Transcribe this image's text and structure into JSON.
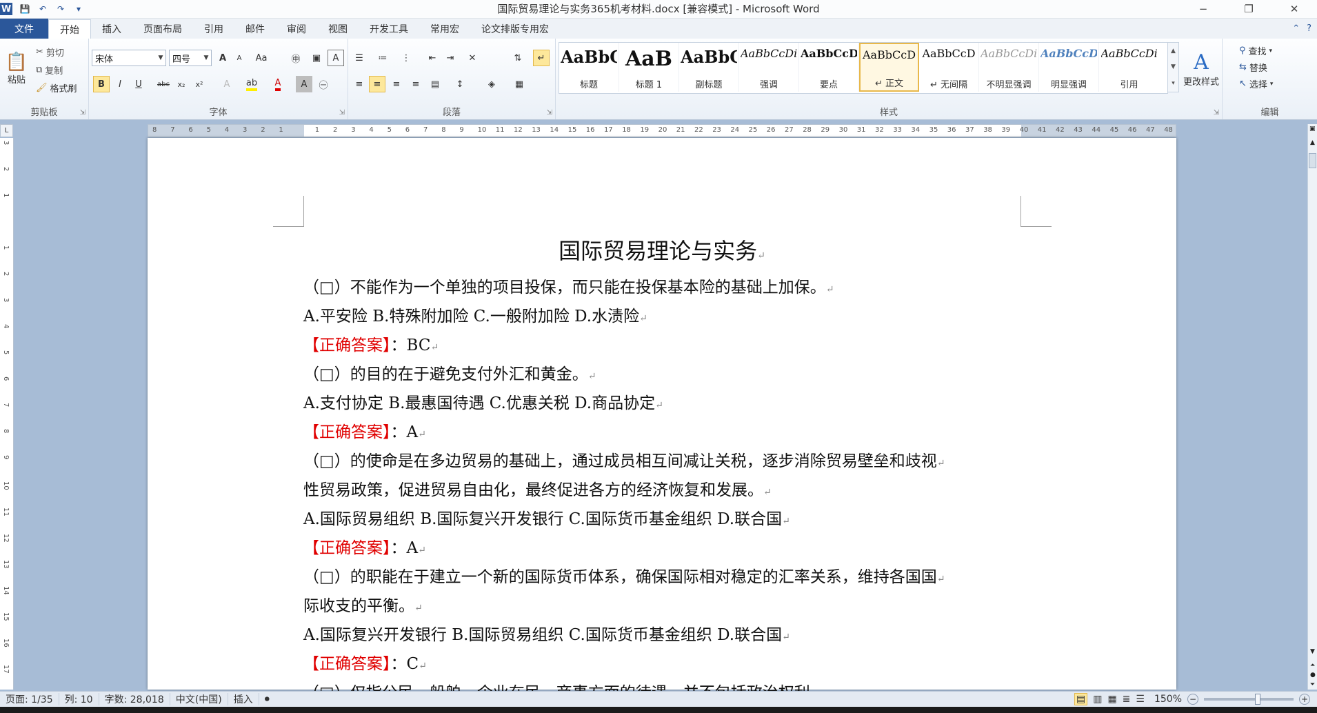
{
  "window": {
    "title": "国际贸易理论与实务365机考材料.docx [兼容模式] - Microsoft Word",
    "minimize": "−",
    "restore": "❐",
    "close": "✕"
  },
  "quick_access": {
    "word_logo": "W",
    "save": "💾",
    "undo": "↶",
    "redo": "↷",
    "more": "▾"
  },
  "tabs": [
    "文件",
    "开始",
    "插入",
    "页面布局",
    "引用",
    "邮件",
    "审阅",
    "视图",
    "开发工具",
    "常用宏",
    "论文排版专用宏"
  ],
  "active_tab": "开始",
  "clipboard": {
    "paste": "粘贴",
    "cut": "剪切",
    "copy": "复制",
    "format_painter": "格式刷",
    "label": "剪贴板"
  },
  "font": {
    "name": "宋体",
    "size": "四号",
    "label": "字体",
    "bold": "B",
    "italic": "I",
    "underline": "U",
    "strike": "abc",
    "subscript": "x₂",
    "superscript": "x²",
    "grow": "A",
    "shrink": "A",
    "case": "Aa",
    "clear": "A",
    "font_color": "A",
    "char_shading": "A"
  },
  "paragraph": {
    "label": "段落"
  },
  "styles": {
    "label": "样式",
    "items": [
      {
        "preview": "AaBbC",
        "name": "标题"
      },
      {
        "preview": "AaB",
        "name": "标题 1"
      },
      {
        "preview": "AaBbC",
        "name": "副标题"
      },
      {
        "preview": "AaBbCcDi",
        "name": "强调"
      },
      {
        "preview": "AaBbCcD",
        "name": "要点"
      },
      {
        "preview": "AaBbCcD",
        "name": "↵ 正文"
      },
      {
        "preview": "AaBbCcD",
        "name": "↵ 无间隔"
      },
      {
        "preview": "AaBbCcDi",
        "name": "不明显强调"
      },
      {
        "preview": "AaBbCcD",
        "name": "明显强调"
      },
      {
        "preview": "AaBbCcDi",
        "name": "引用"
      }
    ],
    "change_styles": "更改样式"
  },
  "editing": {
    "label": "编辑",
    "find": "查找",
    "replace": "替换",
    "select": "选择"
  },
  "ruler_h": [
    "8",
    "7",
    "6",
    "5",
    "4",
    "3",
    "2",
    "1",
    "",
    "1",
    "2",
    "3",
    "4",
    "5",
    "6",
    "7",
    "8",
    "9",
    "10",
    "11",
    "12",
    "13",
    "14",
    "15",
    "16",
    "17",
    "18",
    "19",
    "20",
    "21",
    "22",
    "23",
    "24",
    "25",
    "26",
    "27",
    "28",
    "29",
    "30",
    "31",
    "32",
    "33",
    "34",
    "35",
    "36",
    "37",
    "38",
    "39",
    "40",
    "41",
    "42",
    "43",
    "44",
    "45",
    "46",
    "47",
    "48"
  ],
  "ruler_v": [
    "3",
    "2",
    "1",
    "",
    "1",
    "2",
    "3",
    "4",
    "5",
    "6",
    "7",
    "8",
    "9",
    "10",
    "11",
    "12",
    "13",
    "14",
    "15",
    "16",
    "17"
  ],
  "document": {
    "title": "国际贸易理论与实务",
    "lines": [
      {
        "text": "（□）不能作为一个单独的项目投保，而只能在投保基本险的基础上加保。",
        "kind": "q"
      },
      {
        "text": "A.平安险 B.特殊附加险 C.一般附加险 D.水渍险",
        "kind": "opt"
      },
      {
        "label": "【正确答案】",
        "text": "：BC",
        "kind": "ans"
      },
      {
        "text": "（□）的目的在于避免支付外汇和黄金。",
        "kind": "q"
      },
      {
        "text": "A.支付协定 B.最惠国待遇 C.优惠关税 D.商品协定",
        "kind": "opt"
      },
      {
        "label": "【正确答案】",
        "text": "：A",
        "kind": "ans"
      },
      {
        "text": "（□）的使命是在多边贸易的基础上，通过成员相互间减让关税，逐步消除贸易壁垒和歧视",
        "kind": "q"
      },
      {
        "text": "性贸易政策，促进贸易自由化，最终促进各方的经济恢复和发展。",
        "kind": "q"
      },
      {
        "text": "A.国际贸易组织 B.国际复兴开发银行 C.国际货币基金组织 D.联合国",
        "kind": "opt"
      },
      {
        "label": "【正确答案】",
        "text": "：A",
        "kind": "ans"
      },
      {
        "text": "（□）的职能在于建立一个新的国际货币体系，确保国际相对稳定的汇率关系，维持各国国",
        "kind": "q"
      },
      {
        "text": "际收支的平衡。",
        "kind": "q"
      },
      {
        "text": "A.国际复兴开发银行 B.国际贸易组织 C.国际货币基金组织 D.联合国",
        "kind": "opt"
      },
      {
        "label": "【正确答案】",
        "text": "：C",
        "kind": "ans"
      },
      {
        "text": "（□）仅指公民、船舶、企业在民、商事方面的待遇，并不包括政治权利。",
        "kind": "q"
      }
    ],
    "para_mark": "↵"
  },
  "status": {
    "page": "页面: 1/35",
    "col": "列: 10",
    "words": "字数: 28,018",
    "lang": "中文(中国)",
    "mode": "插入",
    "zoom": "150%",
    "zoom_minus": "−",
    "zoom_plus": "+"
  },
  "colors": {
    "accent": "#2b579a",
    "answer_red": "#e00000"
  }
}
